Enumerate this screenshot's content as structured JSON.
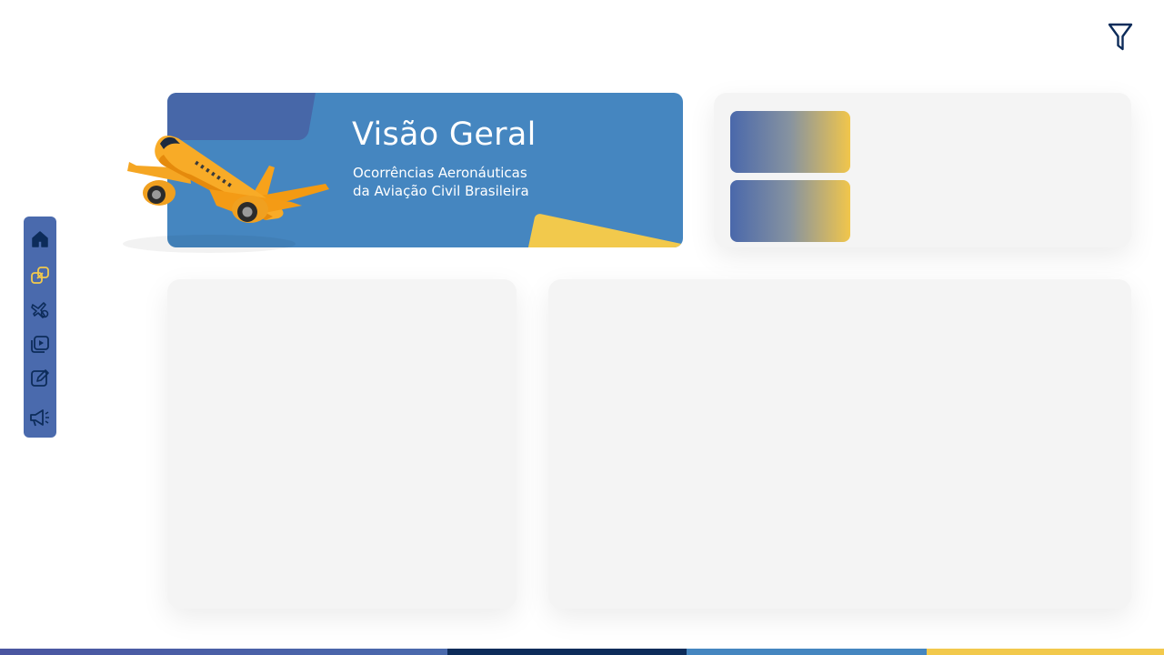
{
  "header": {
    "title": "Visão Geral",
    "subtitle_line1": "Ocorrências Aeronáuticas",
    "subtitle_line2": "da Aviação Civil Brasileira"
  },
  "toolbar": {
    "filter_icon": "filter-icon"
  },
  "nav": {
    "items": [
      {
        "icon": "home-icon",
        "active": false
      },
      {
        "icon": "overview-link-icon",
        "active": true
      },
      {
        "icon": "aircraft-gear-icon",
        "active": false
      },
      {
        "icon": "media-gallery-icon",
        "active": false
      },
      {
        "icon": "edit-note-icon",
        "active": false
      },
      {
        "icon": "megaphone-icon",
        "active": false
      }
    ]
  },
  "colors": {
    "primary_blue": "#4586c0",
    "dark_blue": "#4767a8",
    "navy": "#0d2c5a",
    "accent_yellow": "#f2c94c",
    "card_bg": "#f4f4f4"
  }
}
